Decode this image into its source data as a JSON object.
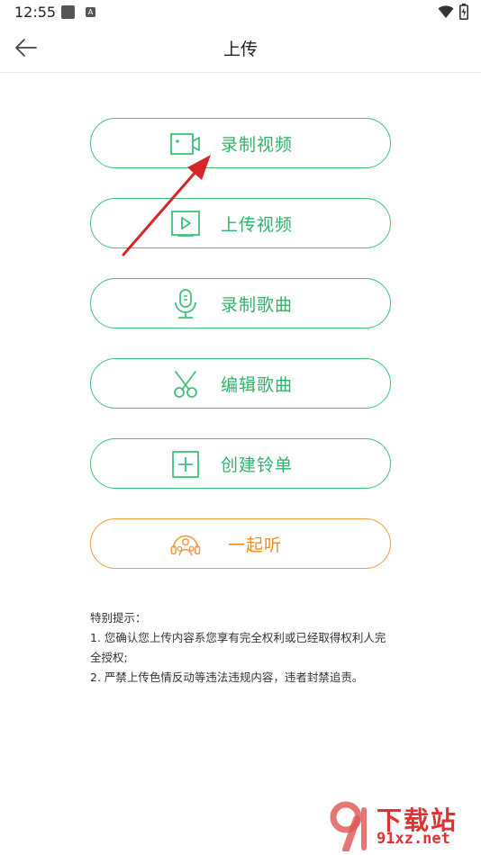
{
  "status_bar": {
    "time": "12:55",
    "badge_letter": "A"
  },
  "header": {
    "title": "上传"
  },
  "actions": [
    {
      "label": "录制视频",
      "icon": "video-camera-icon",
      "color": "#2fb36a"
    },
    {
      "label": "上传视频",
      "icon": "video-play-icon",
      "color": "#2fb36a"
    },
    {
      "label": "录制歌曲",
      "icon": "microphone-icon",
      "color": "#2fb36a"
    },
    {
      "label": "编辑歌曲",
      "icon": "scissors-icon",
      "color": "#2fb36a"
    },
    {
      "label": "创建铃单",
      "icon": "add-square-icon",
      "color": "#2fb36a"
    },
    {
      "label": "一起听",
      "icon": "listen-together-icon",
      "color": "#f08a24"
    }
  ],
  "notice": {
    "title": "特别提示：",
    "line1": "1. 您确认您上传内容系您享有完全权利或已经取得权利人完全授权;",
    "line2": "2. 严禁上传色情反动等违法违规内容，违者封禁追责。"
  },
  "watermark": {
    "top": "下载站",
    "bottom": "91xz.net"
  }
}
